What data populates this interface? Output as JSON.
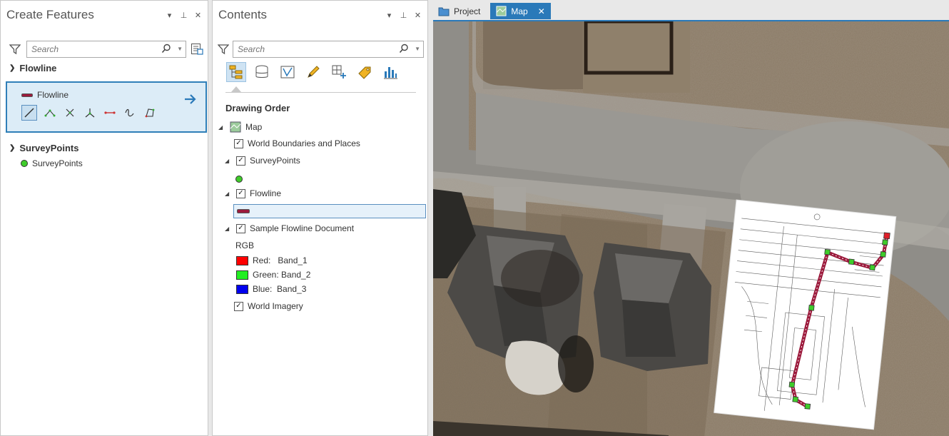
{
  "create_features": {
    "title": "Create Features",
    "search_placeholder": "Search",
    "groups": [
      {
        "label": "Flowline",
        "template_label": "Flowline"
      },
      {
        "label": "SurveyPoints",
        "template_label": "SurveyPoints"
      }
    ],
    "tools": [
      "line",
      "vertex-line",
      "cross",
      "tee",
      "segment",
      "freehand",
      "polygon-trace"
    ]
  },
  "contents": {
    "title": "Contents",
    "search_placeholder": "Search",
    "drawing_order_label": "Drawing Order",
    "map_label": "Map",
    "layers": [
      {
        "label": "World Boundaries and Places",
        "checked": true
      },
      {
        "label": "SurveyPoints",
        "checked": true
      },
      {
        "label": "Flowline",
        "checked": true
      },
      {
        "label": "Sample Flowline Document",
        "checked": true
      },
      {
        "label": "World Imagery",
        "checked": true
      }
    ],
    "rgb_label": "RGB",
    "bands": [
      {
        "label": "Red:   Band_1",
        "color": "#ff0000"
      },
      {
        "label": "Green: Band_2",
        "color": "#22ee22"
      },
      {
        "label": "Blue:  Band_3",
        "color": "#0000ee"
      }
    ]
  },
  "tabs": [
    {
      "label": "Project"
    },
    {
      "label": "Map",
      "close": "✕"
    }
  ],
  "pane_controls": {
    "menu": "▾",
    "pin": "⊥",
    "close": "✕"
  },
  "colors": {
    "accent": "#2a79b9",
    "flowline": "#9c1a3c",
    "survey_point": "#3fcc2a",
    "selection_bg": "#dcecf7"
  }
}
